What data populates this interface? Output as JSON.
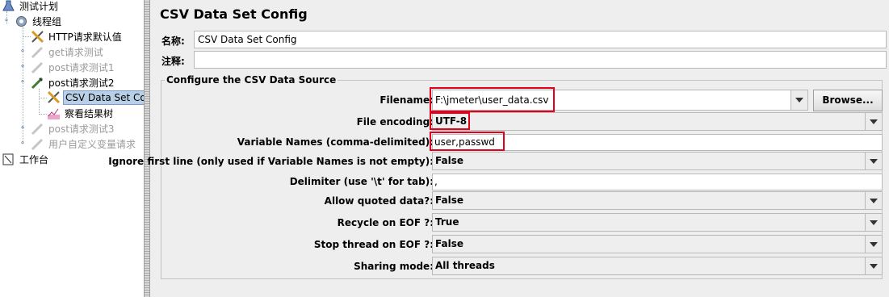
{
  "tree": {
    "items": [
      {
        "label": "测试计划",
        "icon": "test-plan-icon"
      },
      {
        "label": "线程组",
        "icon": "gear-icon"
      },
      {
        "label": "HTTP请求默认值",
        "icon": "tools-icon"
      },
      {
        "label": "get请求测试",
        "icon": "pipette-icon"
      },
      {
        "label": "post请求测试1",
        "icon": "pipette-icon"
      },
      {
        "label": "post请求测试2",
        "icon": "pipette-icon"
      },
      {
        "label": "CSV Data Set Co",
        "icon": "tools-icon"
      },
      {
        "label": "察看结果树",
        "icon": "chart-icon"
      },
      {
        "label": "post请求测试3",
        "icon": "pipette-icon"
      },
      {
        "label": "用户自定义变量请求",
        "icon": "pipette-icon"
      },
      {
        "label": "工作台",
        "icon": "workbench-icon"
      }
    ]
  },
  "panel": {
    "title": "CSV Data Set Config",
    "name_label": "名称:",
    "name_value": "CSV Data Set Config",
    "comment_label": "注释:",
    "comment_value": "",
    "group_title": "Configure the CSV Data Source",
    "filename_label": "Filename:",
    "filename_value": "F:\\jmeter\\user_data.csv",
    "browse_label": "Browse...",
    "encoding_label": "File encoding:",
    "encoding_value": "UTF-8",
    "varnames_label": "Variable Names (comma-delimited):",
    "varnames_value": "user,passwd",
    "ignore_label": "Ignore first line (only used if Variable Names is not empty):",
    "ignore_value": "False",
    "delimiter_label": "Delimiter (use '\\t' for tab):",
    "delimiter_value": ",",
    "quoted_label": "Allow quoted data?:",
    "quoted_value": "False",
    "recycle_label": "Recycle on EOF ?:",
    "recycle_value": "True",
    "stopthread_label": "Stop thread on EOF ?:",
    "stopthread_value": "False",
    "sharing_label": "Sharing mode:",
    "sharing_value": "All threads"
  },
  "colors": {
    "highlight": "#e2001a",
    "selection": "#b8cfe5"
  }
}
